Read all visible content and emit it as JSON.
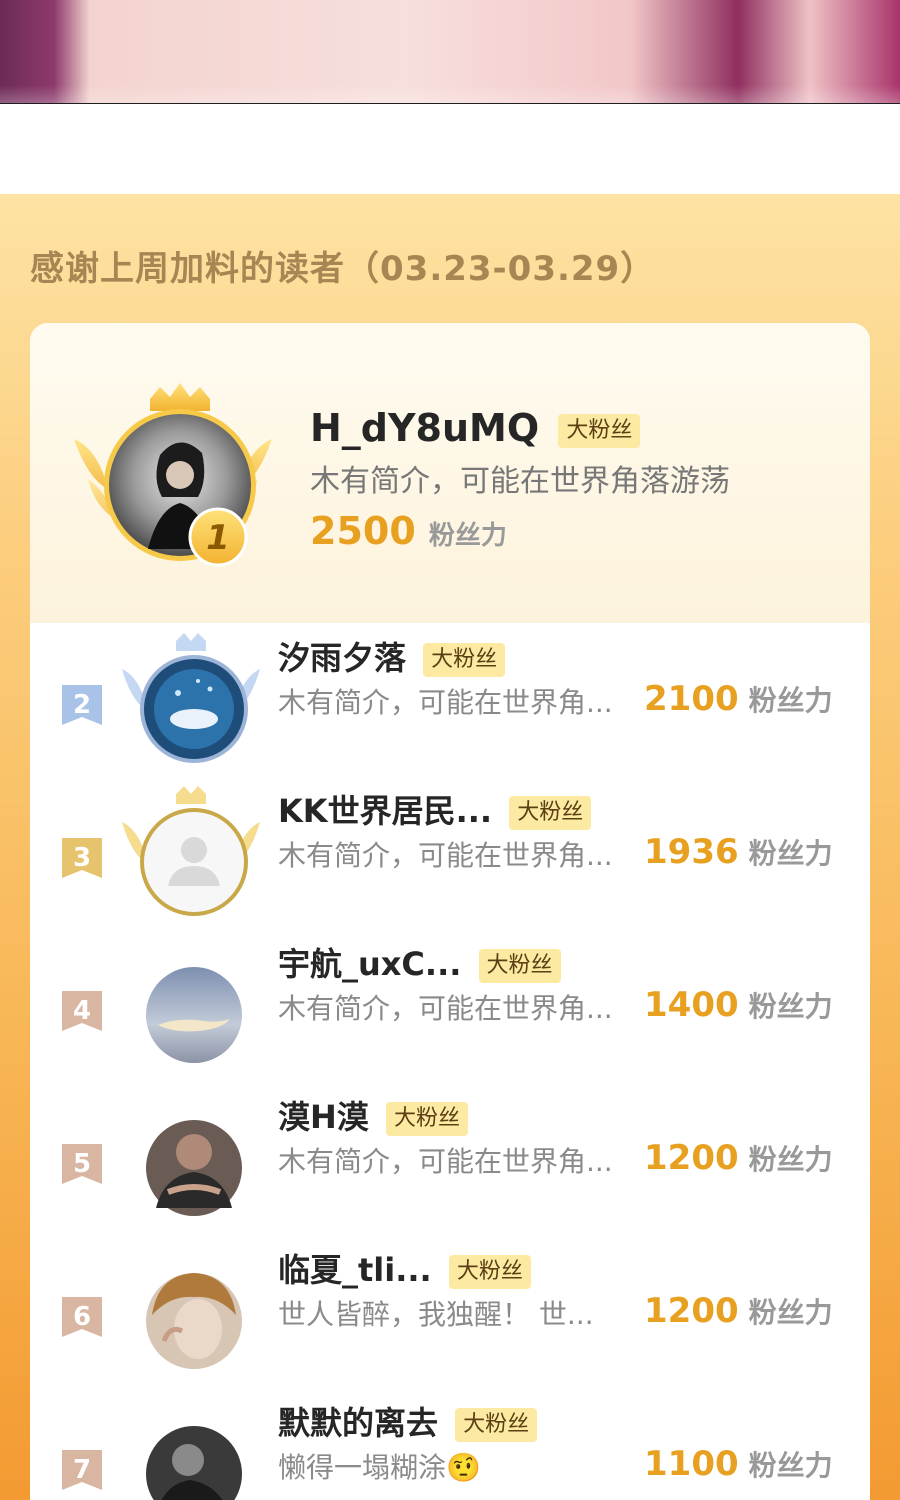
{
  "section_title": "感谢上周加料的读者（03.23-03.29）",
  "colors": {
    "accent": "#e8a020",
    "badge_bg": "#fdeaa2",
    "panel_top": "#fde3a4",
    "panel_bottom": "#f39a32"
  },
  "top_fan": {
    "rank": "1",
    "name": "H_dY8uMQ",
    "badge": "大粉丝",
    "bio": "木有简介，可能在世界角落游荡",
    "points": "2500",
    "points_unit": "粉丝力"
  },
  "fans": [
    {
      "rank": "2",
      "name": "汐雨夕落",
      "badge": "大粉丝",
      "bio": "木有简介，可能在世界角...",
      "points": "2100",
      "points_unit": "粉丝力",
      "avatar": "whale-art"
    },
    {
      "rank": "3",
      "name": "KK世界居民...",
      "badge": "大粉丝",
      "bio": "木有简介，可能在世界角...",
      "points": "1936",
      "points_unit": "粉丝力",
      "avatar": "default-user"
    },
    {
      "rank": "4",
      "name": "宇航_uxC...",
      "badge": "大粉丝",
      "bio": "木有简介，可能在世界角...",
      "points": "1400",
      "points_unit": "粉丝力",
      "avatar": "sky-photo"
    },
    {
      "rank": "5",
      "name": "漠H漠",
      "badge": "大粉丝",
      "bio": "木有简介，可能在世界角...",
      "points": "1200",
      "points_unit": "粉丝力",
      "avatar": "person-photo"
    },
    {
      "rank": "6",
      "name": "临夏_tli...",
      "badge": "大粉丝",
      "bio": "世人皆醉，我独醒！ 世...",
      "points": "1200",
      "points_unit": "粉丝力",
      "avatar": "portrait-photo"
    },
    {
      "rank": "7",
      "name": "默默的离去",
      "badge": "大粉丝",
      "bio": "懒得一塌糊涂🤨",
      "points": "1100",
      "points_unit": "粉丝力",
      "avatar": "dark-photo"
    }
  ]
}
